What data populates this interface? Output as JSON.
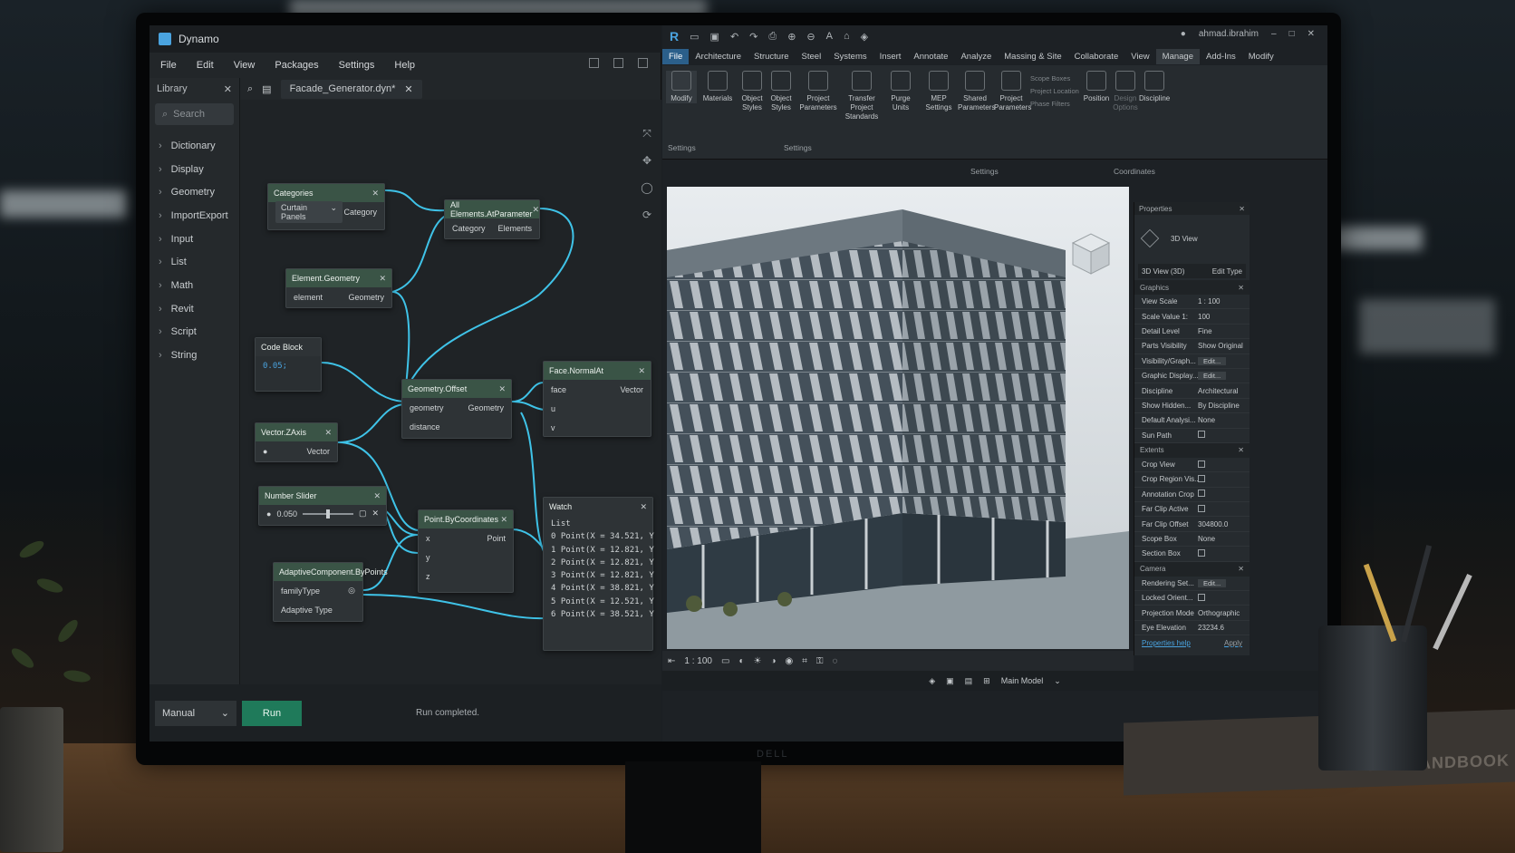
{
  "dynamo": {
    "title": "Dynamo",
    "menu": [
      "File",
      "Edit",
      "View",
      "Packages",
      "Settings",
      "Help"
    ],
    "library": {
      "title": "Library",
      "search_placeholder": "Search",
      "items": [
        "Dictionary",
        "Display",
        "Geometry",
        "ImportExport",
        "Input",
        "List",
        "Math",
        "Revit",
        "Script",
        "String"
      ]
    },
    "tab": "Facade_Generator.dyn*",
    "nodes": {
      "categories": {
        "title": "Categories",
        "dropdown": "Curtain Panels",
        "out": "Category"
      },
      "all_elements": {
        "title": "All Elements.AtParameter",
        "in": "Category",
        "out": "Elements"
      },
      "element_geometry": {
        "title": "Element.Geometry",
        "in": "element",
        "out": "Geometry"
      },
      "code_block": {
        "title": "Code Block",
        "code": "0.05;"
      },
      "geometry_offset": {
        "title": "Geometry.Offset",
        "in1": "geometry",
        "in2": "distance",
        "out": "Geometry"
      },
      "face_normal": {
        "title": "Face.NormalAt",
        "in1": "face",
        "in2": "u",
        "in3": "v",
        "out": "Vector"
      },
      "vector_zaxis": {
        "title": "Vector.ZAxis",
        "out": "Vector"
      },
      "number_slider": {
        "title": "Number Slider",
        "value": "0.050"
      },
      "point_by_coords": {
        "title": "Point.ByCoordinates",
        "in1": "x",
        "in2": "y",
        "in3": "z",
        "out": "Point"
      },
      "adaptive": {
        "title": "AdaptiveComponent.ByPoints",
        "in1": "familyType",
        "in2": "Adaptive Type"
      },
      "watch": {
        "title": "Watch",
        "label": "List",
        "items": [
          "Point(X = 34.521, Y",
          "Point(X = 12.821, Y",
          "Point(X = 12.821, Y",
          "Point(X = 12.821, Y",
          "Point(X = 38.821, Y",
          "Point(X = 12.521, Y",
          "Point(X = 38.521, Y"
        ],
        "indices": [
          "0",
          "1",
          "2",
          "3",
          "4",
          "5",
          "6"
        ]
      }
    },
    "footer": {
      "run_mode": "Manual",
      "run_button": "Run",
      "status": "Run completed."
    }
  },
  "revit": {
    "user": "ahmad.ibrahim",
    "tabs": [
      "File",
      "Architecture",
      "Structure",
      "Steel",
      "Systems",
      "Insert",
      "Annotate",
      "Analyze",
      "Massing & Site",
      "Collaborate",
      "View",
      "Manage",
      "Add-Ins",
      "Modify"
    ],
    "active_tab": "Manage",
    "ribbon_buttons": [
      "Modify",
      "Materials",
      "Object Styles",
      "Object Styles",
      "Project Parameters",
      "Transfer Project Standards",
      "Purge Units",
      "MEP Settings",
      "Shared Parameters",
      "Project Parameters",
      "Position",
      "Design Options",
      "Discipline"
    ],
    "ribbon_side": [
      "Scope Boxes",
      "Project Location",
      "Phase Filters"
    ],
    "groups": [
      "Settings",
      "Settings",
      "Settings",
      "Coordinates"
    ],
    "view_scale": "1 : 100",
    "model": "Main Model",
    "properties": {
      "title": "Properties",
      "type": "3D View",
      "selector": "3D View (3D)",
      "edit_type": "Edit Type",
      "sections": [
        "Graphics",
        "Extents",
        "Camera"
      ],
      "graphics": [
        {
          "k": "View Scale",
          "v": "1 : 100"
        },
        {
          "k": "Scale Value 1:",
          "v": "100"
        },
        {
          "k": "Detail Level",
          "v": "Fine"
        },
        {
          "k": "Parts Visibility",
          "v": "Show Original"
        },
        {
          "k": "Visibility/Graph...",
          "v": "Edit..."
        },
        {
          "k": "Graphic Display...",
          "v": "Edit..."
        },
        {
          "k": "Discipline",
          "v": "Architectural"
        },
        {
          "k": "Show Hidden...",
          "v": "By Discipline"
        },
        {
          "k": "Default Analysi...",
          "v": "None"
        },
        {
          "k": "Sun Path",
          "v": ""
        }
      ],
      "extents": [
        {
          "k": "Crop View",
          "v": ""
        },
        {
          "k": "Crop Region Vis...",
          "v": ""
        },
        {
          "k": "Annotation Crop",
          "v": ""
        },
        {
          "k": "Far Clip Active",
          "v": ""
        },
        {
          "k": "Far Clip Offset",
          "v": "304800.0"
        },
        {
          "k": "Scope Box",
          "v": "None"
        },
        {
          "k": "Section Box",
          "v": ""
        }
      ],
      "camera": [
        {
          "k": "Rendering Set...",
          "v": "Edit..."
        },
        {
          "k": "Locked Orient...",
          "v": ""
        },
        {
          "k": "Projection Mode",
          "v": "Orthographic"
        },
        {
          "k": "Eye Elevation",
          "v": "23234.6"
        }
      ],
      "help": "Properties help",
      "apply": "Apply"
    }
  },
  "monitor_brand": "DELL",
  "book_title": "BIM HANDBOOK"
}
